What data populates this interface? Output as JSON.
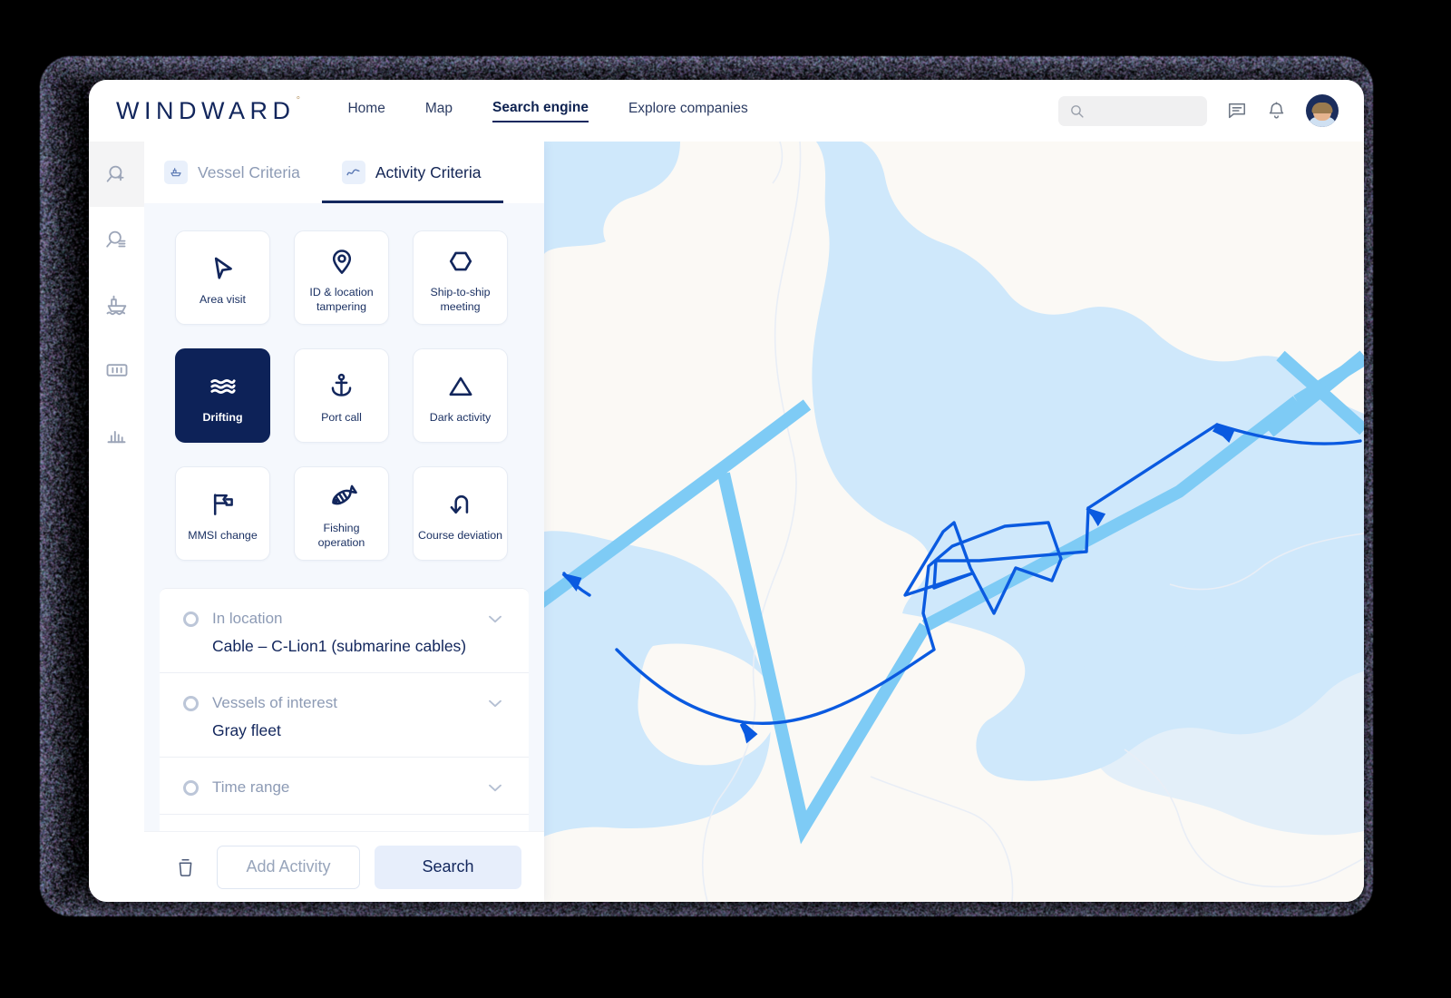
{
  "header": {
    "logo": "WINDWARD",
    "logo_mark": "°",
    "nav": [
      {
        "label": "Home",
        "active": false
      },
      {
        "label": "Map",
        "active": false
      },
      {
        "label": "Search engine",
        "active": true
      },
      {
        "label": "Explore companies",
        "active": false
      }
    ],
    "search_placeholder": "",
    "search_value": "",
    "icons": [
      "search-icon",
      "messages-icon",
      "notification-bell-icon",
      "user-avatar"
    ]
  },
  "rail": {
    "items": [
      {
        "name": "new-search-icon",
        "active": true
      },
      {
        "name": "saved-search-icon",
        "active": false
      },
      {
        "name": "vessel-icon",
        "active": false
      },
      {
        "name": "container-icon",
        "active": false
      },
      {
        "name": "statistics-icon",
        "active": false
      }
    ]
  },
  "panel": {
    "tabs": [
      {
        "label": "Vessel Criteria",
        "icon": "vessel-icon",
        "active": false
      },
      {
        "label": "Activity Criteria",
        "icon": "activity-trend-icon",
        "active": true
      }
    ],
    "activity_cards": [
      {
        "label": "Area visit",
        "icon": "cursor-arrow-icon",
        "selected": false
      },
      {
        "label": "ID & location tampering",
        "icon": "location-pin-icon",
        "selected": false
      },
      {
        "label": "Ship-to-ship meeting",
        "icon": "hexagon-icon",
        "selected": false
      },
      {
        "label": "Drifting",
        "icon": "waves-icon",
        "selected": true
      },
      {
        "label": "Port call",
        "icon": "anchor-icon",
        "selected": false
      },
      {
        "label": "Dark activity",
        "icon": "triangle-icon",
        "selected": false
      },
      {
        "label": "MMSI change",
        "icon": "flag-icon",
        "selected": false
      },
      {
        "label": "Fishing operation",
        "icon": "fish-bone-icon",
        "selected": false
      },
      {
        "label": "Course deviation",
        "icon": "u-turn-arrow-icon",
        "selected": false
      }
    ],
    "filters": [
      {
        "label": "In location",
        "value": "Cable – C-Lion1 (submarine cables)"
      },
      {
        "label": "Vessels of interest",
        "value": "Gray fleet"
      },
      {
        "label": "Time range",
        "value": ""
      }
    ],
    "actions": {
      "delete_icon": "trash-icon",
      "add_activity_label": "Add Activity",
      "search_label": "Search"
    }
  },
  "map": {
    "land_color": "#fbf9f5",
    "water_color": "#cfe8fb",
    "cable_color": "#7ecbf5",
    "track_color": "#0a5ae0",
    "border_color": "#e9eef6"
  },
  "theme": {
    "navy": "#0d2258",
    "accent_blue": "#13285e",
    "panel_bg": "#f5f8fd",
    "muted_text": "#8d9bb5"
  }
}
